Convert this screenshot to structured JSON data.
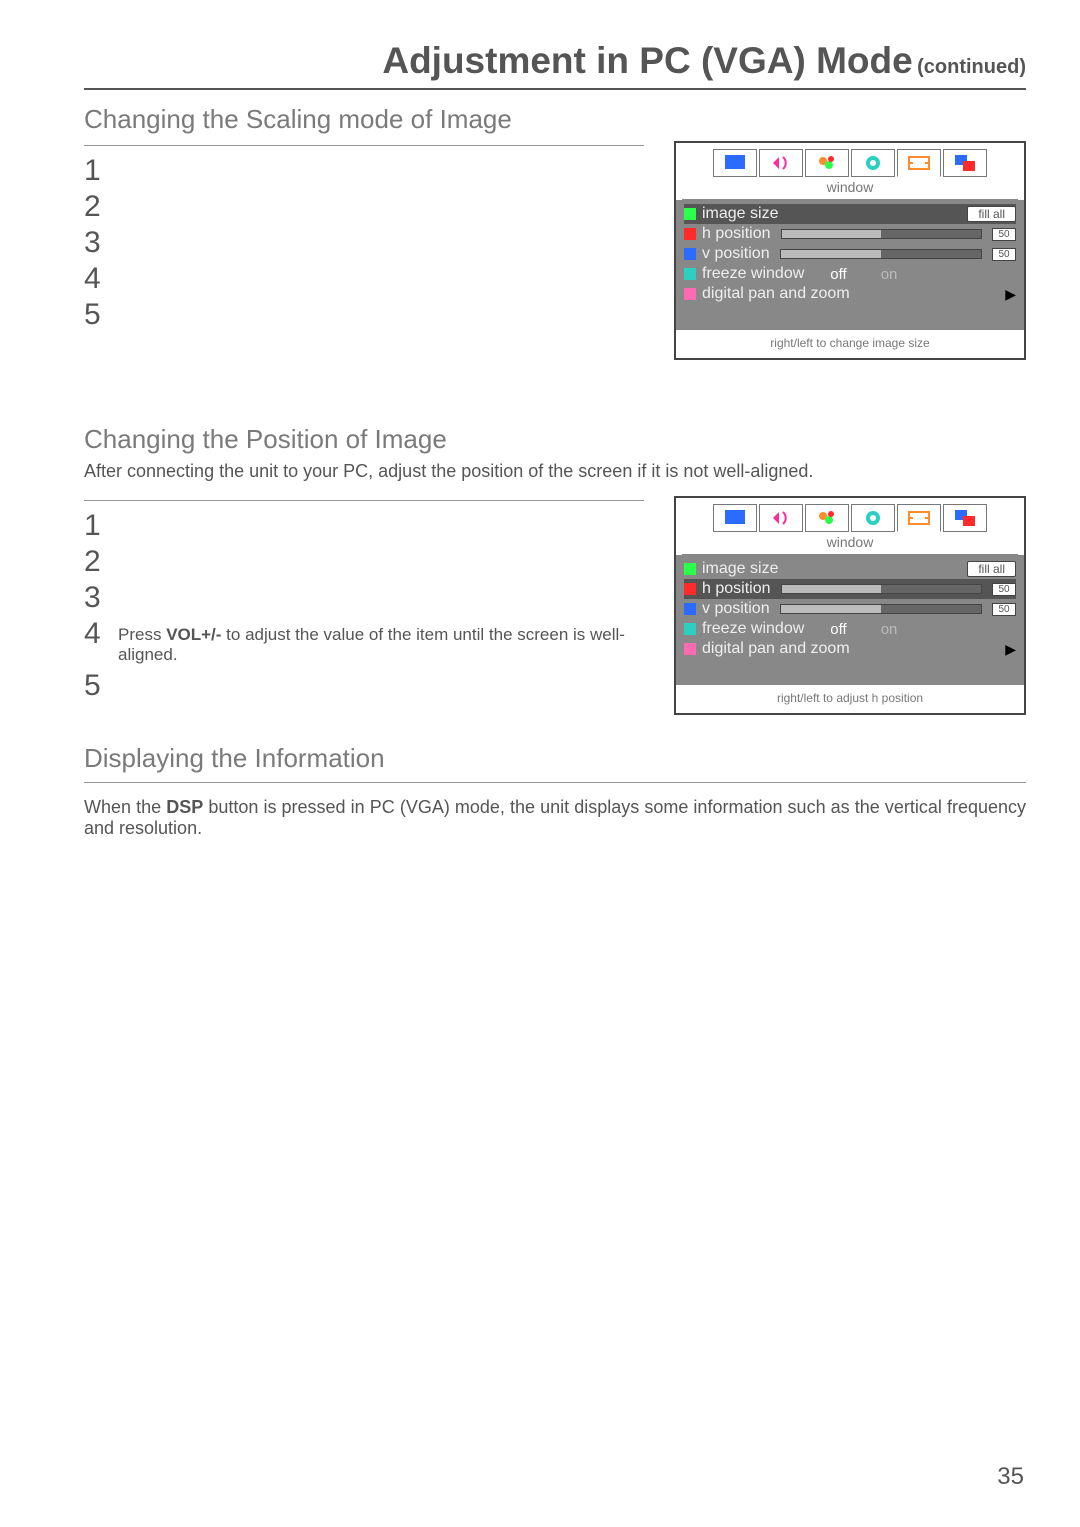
{
  "title": {
    "main": "Adjustment in PC (VGA) Mode",
    "suffix": "(continued)"
  },
  "section1": {
    "heading": "Changing the Scaling mode of Image",
    "steps": [
      "1",
      "2",
      "3",
      "4",
      "5"
    ]
  },
  "section2": {
    "heading": "Changing the Position of Image",
    "intro": "After connecting the unit to your PC, adjust the position of the screen if it is not well-aligned.",
    "steps": [
      "1",
      "2",
      "3",
      "4",
      "5"
    ],
    "step4_pre": "Press ",
    "step4_key": "VOL+/-",
    "step4_post": " to adjust the value of the item until the screen is well-aligned."
  },
  "section3": {
    "heading": "Displaying the Information",
    "body_pre": "When the ",
    "body_key": "DSP",
    "body_post": " button is pressed in PC (VGA) mode, the unit displays some information such as the vertical frequency and resolution."
  },
  "osd1": {
    "tab_label": "window",
    "items": {
      "image_size": {
        "label": "image size",
        "value": "fill all"
      },
      "h_position": {
        "label": "h position",
        "value": "50"
      },
      "v_position": {
        "label": "v position",
        "value": "50"
      },
      "freeze_window": {
        "label": "freeze window",
        "off": "off",
        "on": "on"
      },
      "dpz": {
        "label": "digital pan and zoom"
      }
    },
    "hint": "right/left to change image size"
  },
  "osd2": {
    "tab_label": "window",
    "items": {
      "image_size": {
        "label": "image size",
        "value": "fill all"
      },
      "h_position": {
        "label": "h position",
        "value": "50"
      },
      "v_position": {
        "label": "v position",
        "value": "50"
      },
      "freeze_window": {
        "label": "freeze window",
        "off": "off",
        "on": "on"
      },
      "dpz": {
        "label": "digital pan and zoom"
      }
    },
    "hint": "right/left to adjust h position"
  },
  "page_number": "35"
}
